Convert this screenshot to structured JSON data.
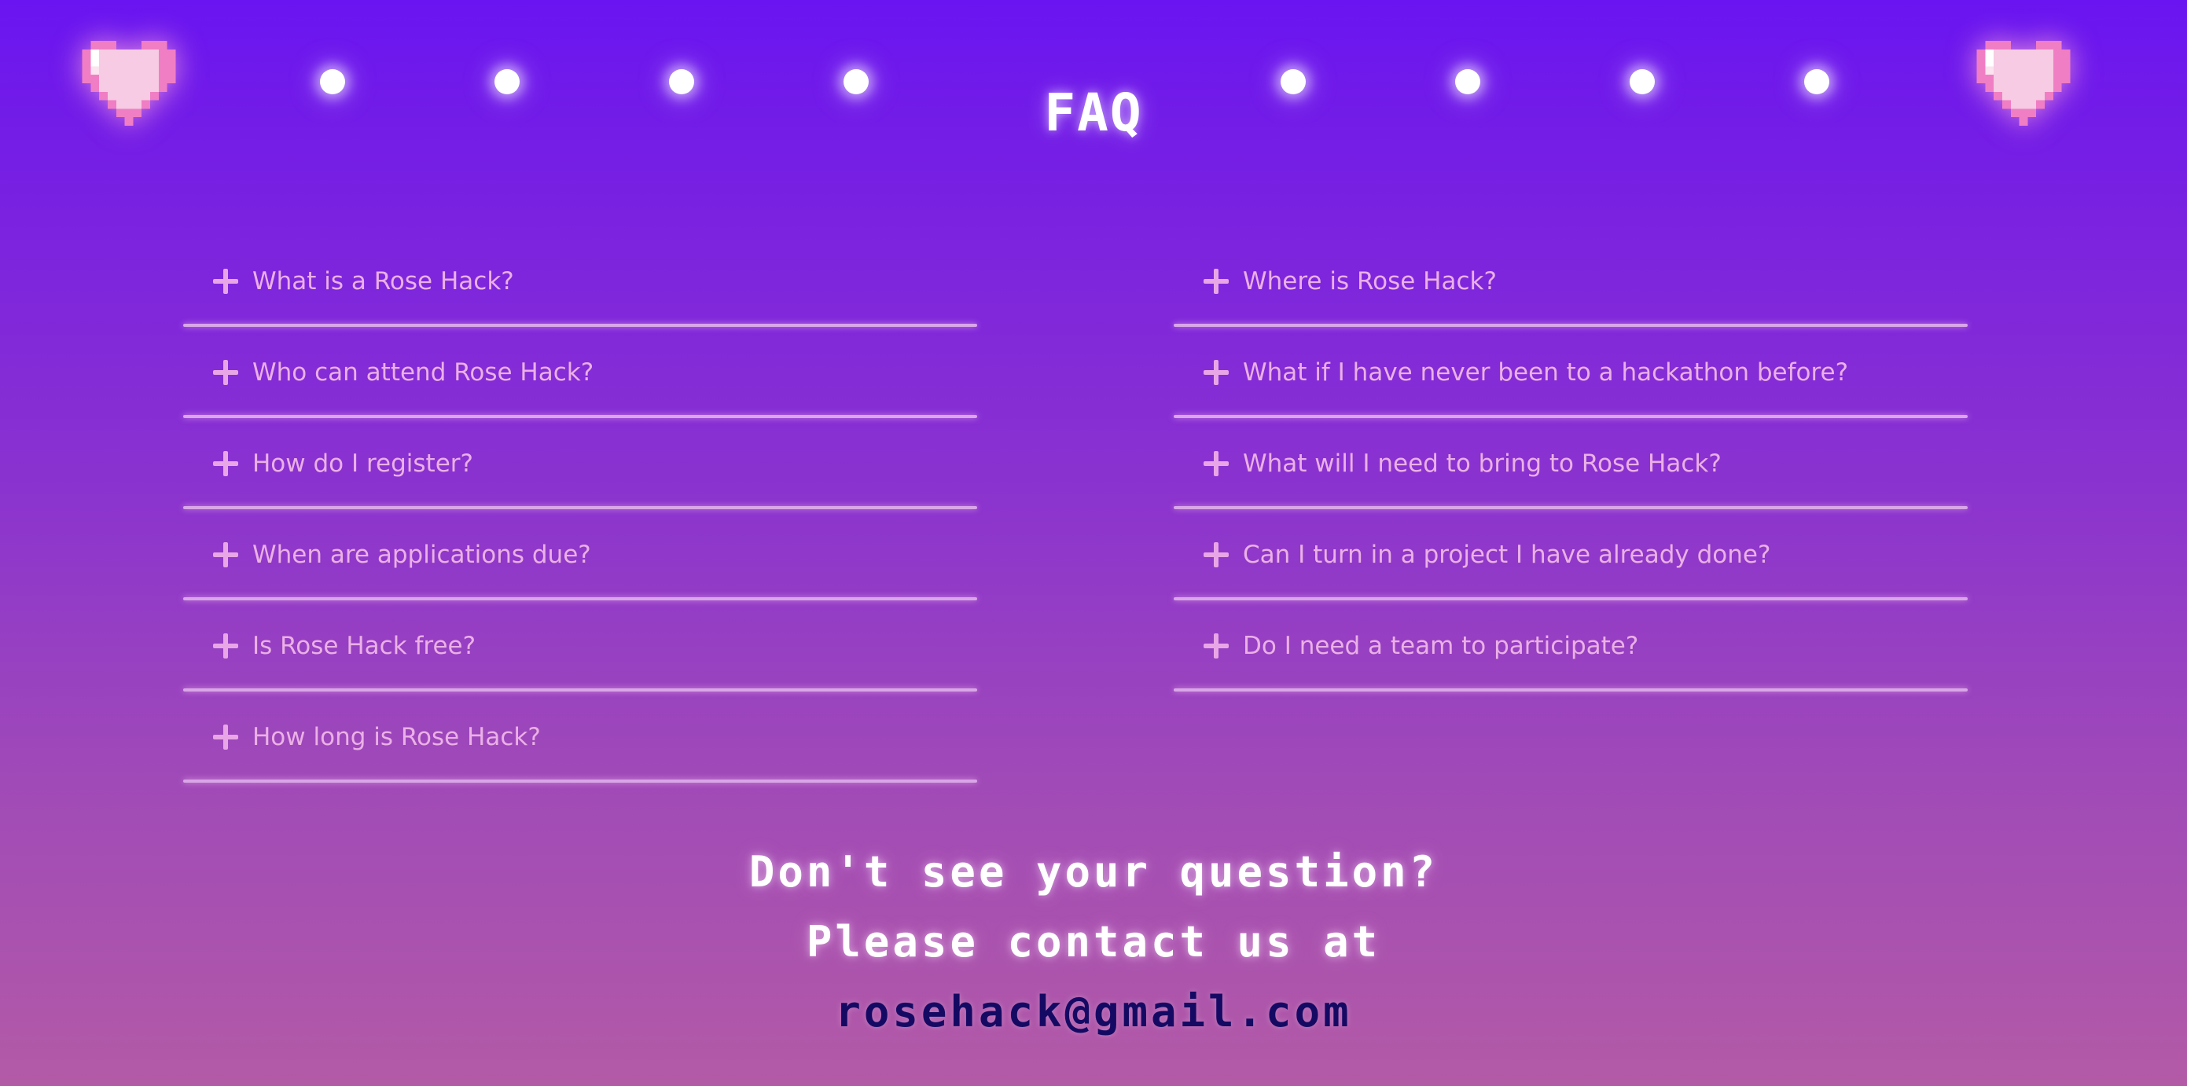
{
  "header": {
    "title": "FAQ",
    "left_icon": "pixel-heart-icon",
    "right_icon": "pixel-heart-icon",
    "dot_count": 8
  },
  "faq": {
    "left": [
      {
        "question": "What is a Rose Hack?"
      },
      {
        "question": "Who can attend Rose Hack?"
      },
      {
        "question": "How do I register?"
      },
      {
        "question": "When are applications due?"
      },
      {
        "question": "Is Rose Hack free?"
      },
      {
        "question": "How long is Rose Hack?"
      }
    ],
    "right": [
      {
        "question": "Where is Rose Hack?"
      },
      {
        "question": "What if I have never been to a hackathon before?"
      },
      {
        "question": "What will I need to bring to Rose Hack?"
      },
      {
        "question": "Can I turn in a project I have already done?"
      },
      {
        "question": "Do I need a team to participate?"
      }
    ],
    "expand_icon": "plus-icon"
  },
  "contact": {
    "line1": "Don't see your question?",
    "line2": "Please contact us at",
    "email": "rosehack@gmail.com"
  },
  "colors": {
    "background_top": "#6a15f1",
    "background_bottom": "#b35aa6",
    "question_text": "#ebb0e5",
    "divider": "#d9a6e8",
    "email": "#150a63",
    "heart": "#f5c6e2"
  }
}
